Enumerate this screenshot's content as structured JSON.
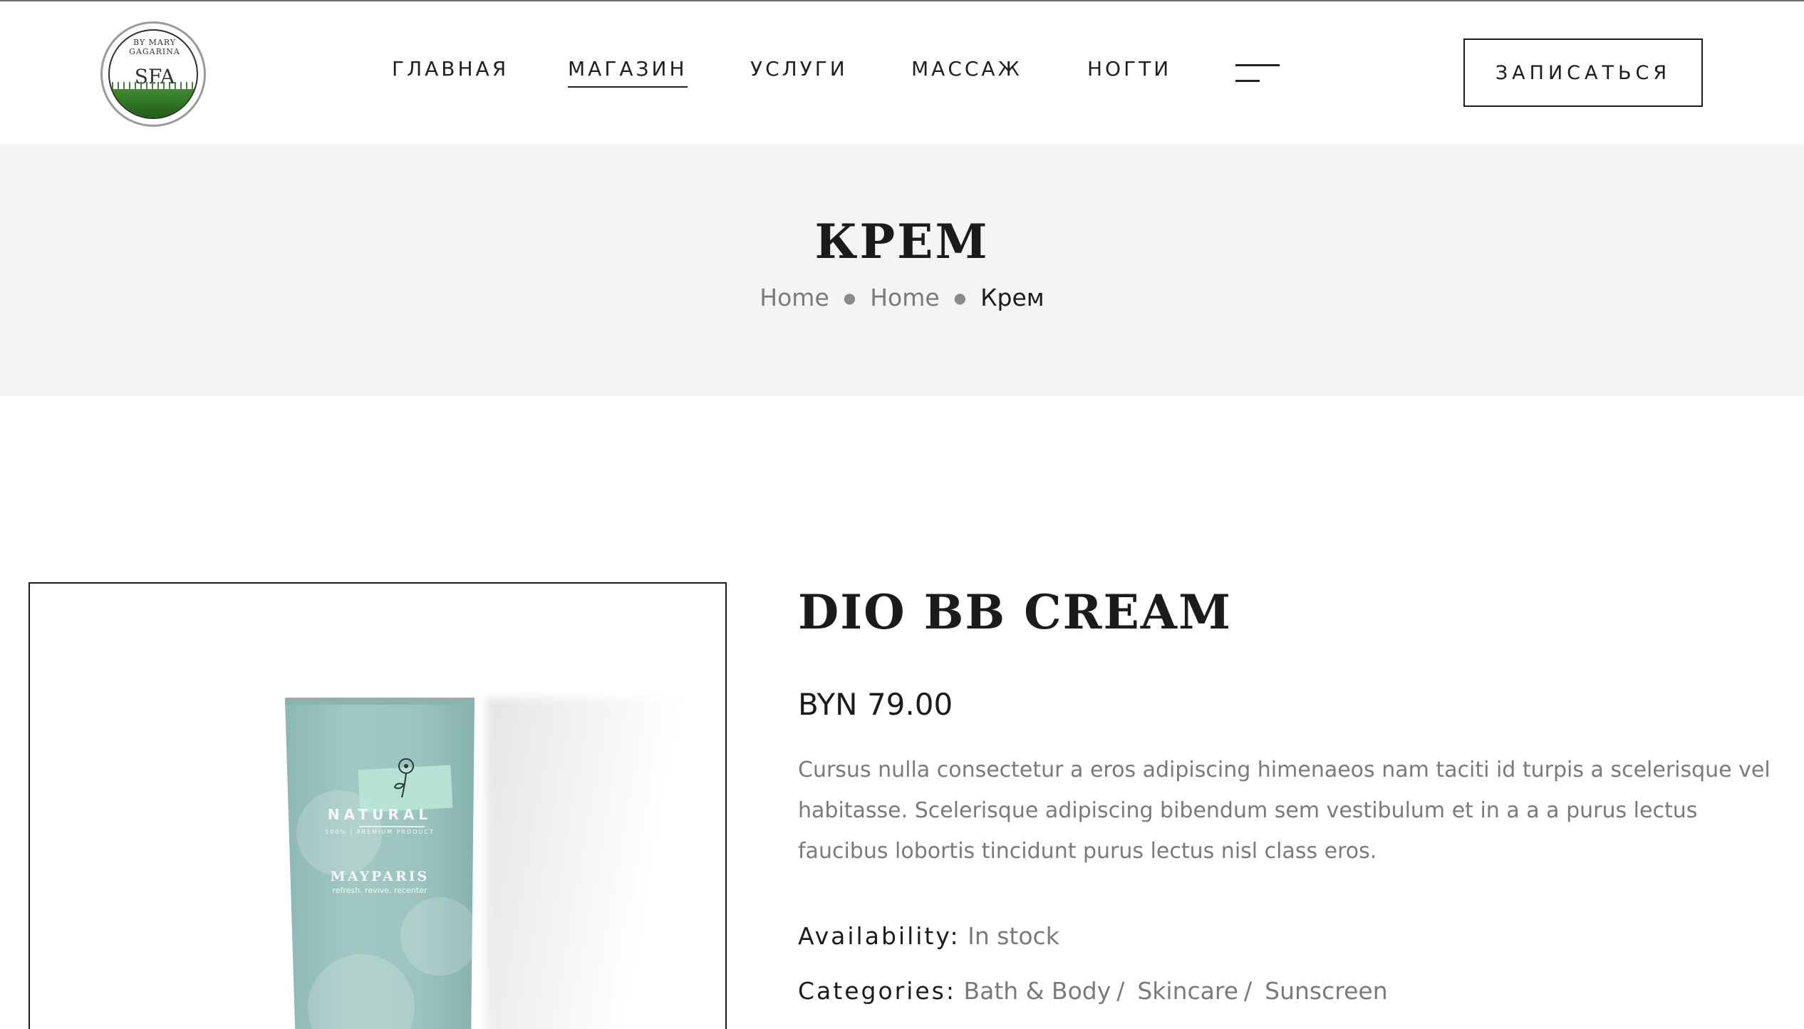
{
  "header": {
    "logo": {
      "text": "SFA",
      "arc_text": "BY MARY GAGARINA"
    },
    "nav": [
      {
        "label": "ГЛАВНАЯ",
        "active": false
      },
      {
        "label": "МАГАЗИН",
        "active": true
      },
      {
        "label": "УСЛУГИ",
        "active": false
      },
      {
        "label": "МАССАЖ",
        "active": false
      },
      {
        "label": "НОГТИ",
        "active": false
      }
    ],
    "menu_icon": "hamburger-menu-icon",
    "cta_label": "ЗАПИСАТЬСЯ"
  },
  "hero": {
    "title": "КРЕМ",
    "breadcrumb": {
      "items": [
        "Home",
        "Home"
      ],
      "current": "Крем"
    }
  },
  "product": {
    "image": {
      "brand": "NATURAL",
      "tagline": "100% | PREMIUM PRODUCT",
      "name": "MAYPARIS",
      "subtitle": "refresh. revive. recenter"
    },
    "title": "DIO BB CREAM",
    "price": "BYN 79.00",
    "description": "Cursus nulla consectetur a eros adipiscing himenaeos nam taciti id turpis a scelerisque vel habitasse. Scelerisque adipiscing bibendum sem vestibulum et in a a a purus lectus faucibus lobortis tincidunt purus lectus nisl class eros.",
    "availability_label": "Availability:",
    "availability_value": "In stock",
    "categories_label": "Categories:",
    "categories": [
      "Bath & Body",
      "Skincare",
      "Sunscreen"
    ],
    "category_separator": "/"
  },
  "colors": {
    "hero_bg": "#f5f4f2",
    "text_dark": "#1b1b1b",
    "text_muted": "#7a7a7a",
    "tube_teal": "#9cc4bf"
  }
}
